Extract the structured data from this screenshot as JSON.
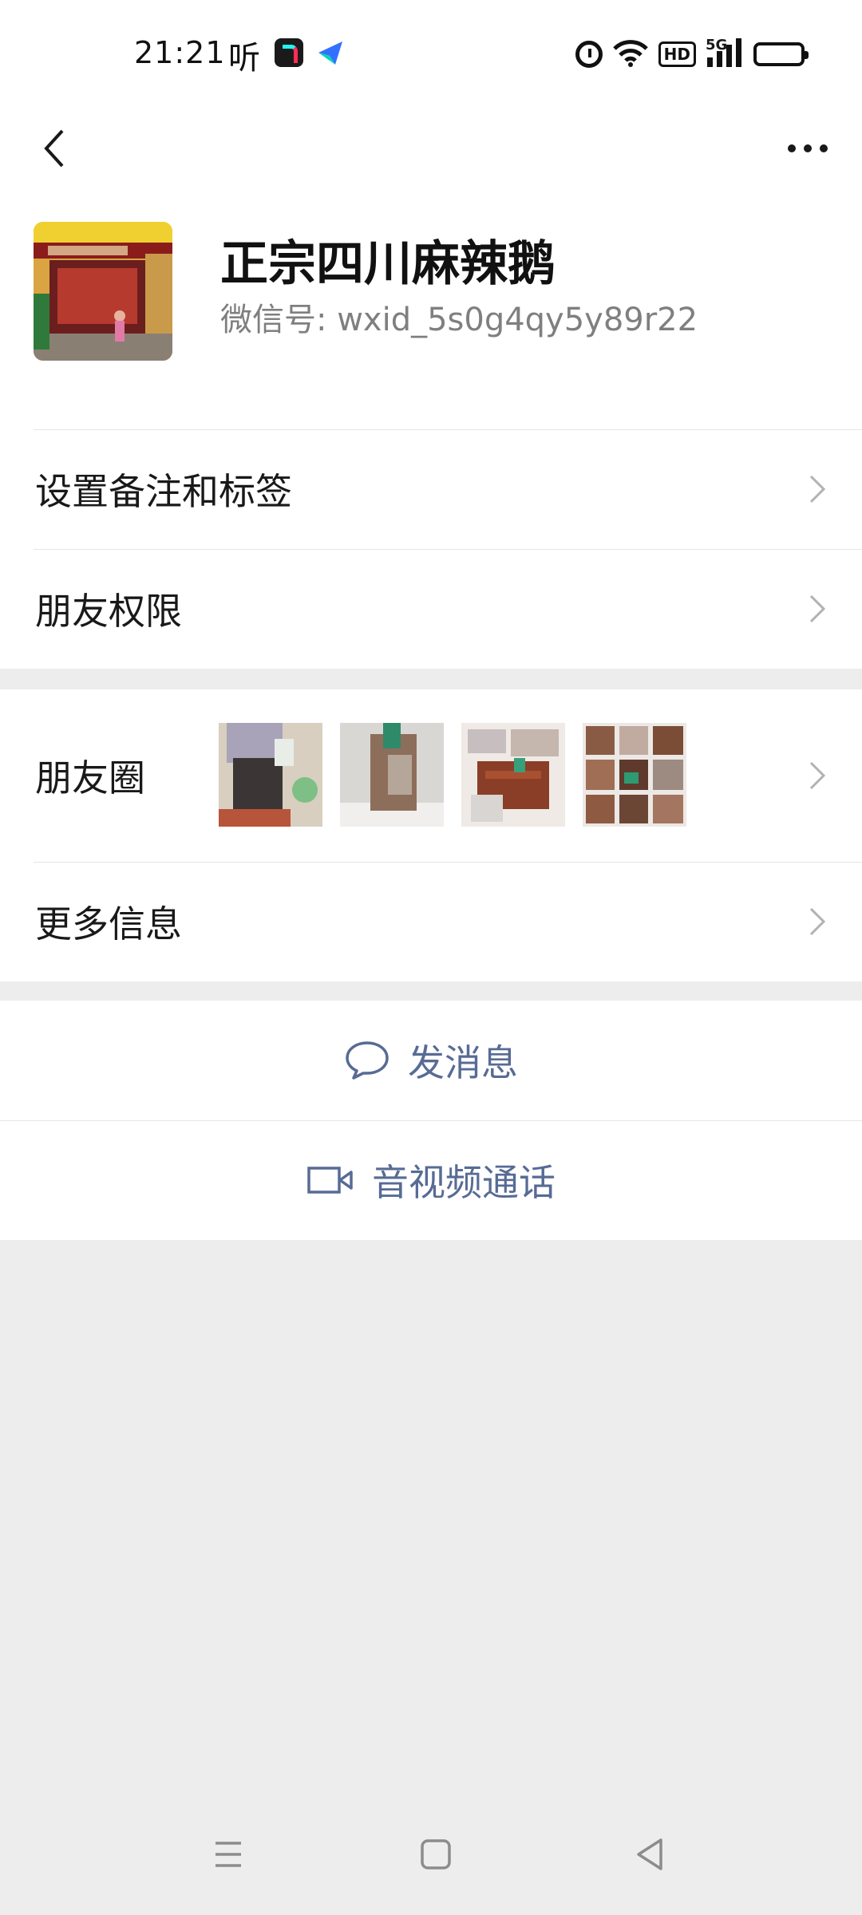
{
  "status_bar": {
    "time": "21:21",
    "ting_char": "听",
    "app_icons": [
      "douyin-app-icon",
      "feishu-app-icon"
    ],
    "right_icons": [
      "alarm-icon",
      "wifi-icon",
      "hd-icon",
      "5g-signal-icon",
      "battery-icon"
    ],
    "hd_label": "HD",
    "network_label": "5G"
  },
  "top_nav": {
    "back_icon": "chevron-left-icon",
    "more_icon": "more-horizontal-icon"
  },
  "profile": {
    "nickname": "正宗四川麻辣鹅",
    "wechat_id": "微信号: wxid_5s0g4qy5y89r22",
    "avatar": "avatar-photo"
  },
  "cells": {
    "remark_tags": "设置备注和标签",
    "friend_permission": "朋友权限",
    "moments": "朋友圈",
    "more_info": "更多信息"
  },
  "moments_thumbnails": [
    "moment-photo-1",
    "moment-photo-2",
    "moment-photo-3",
    "moment-photo-4"
  ],
  "actions": {
    "send_message": "发消息",
    "video_call": "音视频通话"
  },
  "colors": {
    "link_blue": "#576b95",
    "background": "#ededed",
    "card": "#ffffff",
    "secondary_text": "#7f7f7f"
  }
}
